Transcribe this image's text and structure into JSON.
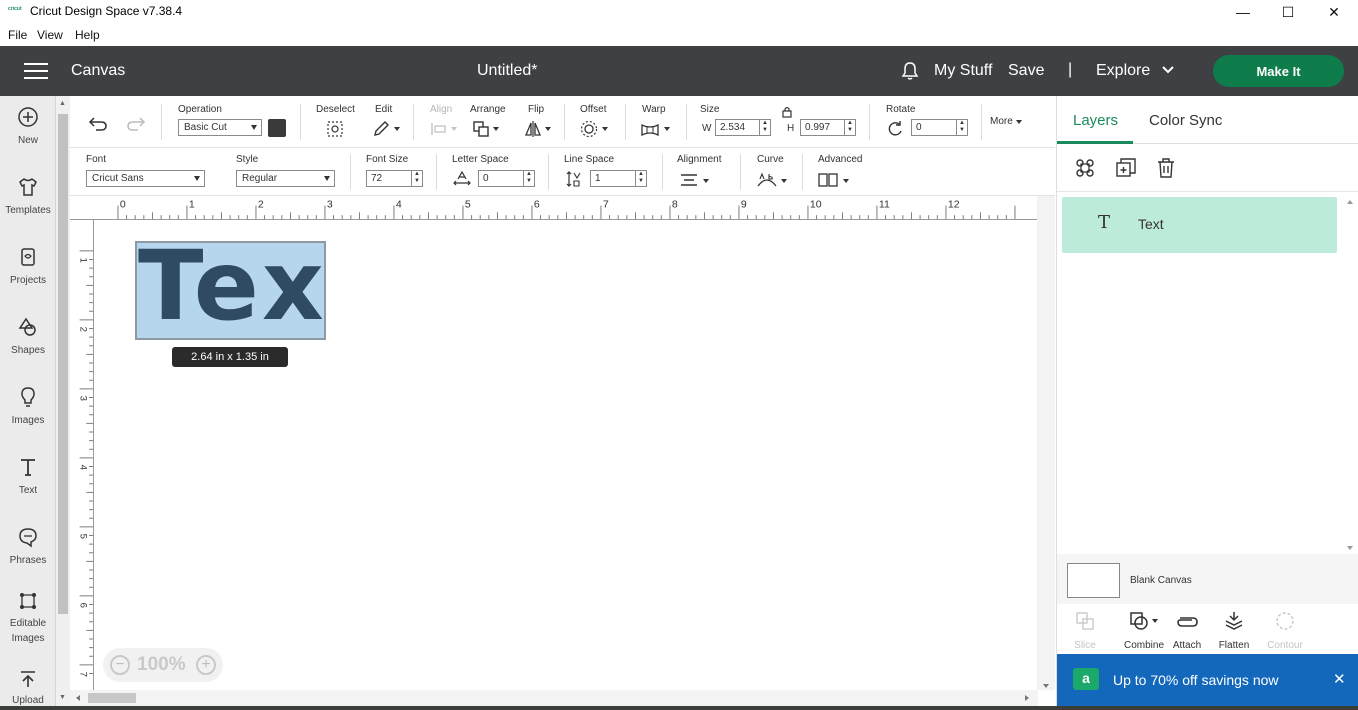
{
  "window": {
    "logo_text": "cricut",
    "title": "Cricut Design Space  v7.38.4",
    "minimize": "—",
    "maximize": "☐",
    "close": "✕"
  },
  "menu": [
    "File",
    "View",
    "Help"
  ],
  "header": {
    "section": "Canvas",
    "project_title": "Untitled*",
    "my_stuff": "My Stuff",
    "save": "Save",
    "separator": "|",
    "explore": "Explore",
    "make_it": "Make It"
  },
  "sidebar": {
    "items": [
      {
        "label": "New",
        "icon": "plus-circle-icon"
      },
      {
        "label": "Templates",
        "icon": "tshirt-icon"
      },
      {
        "label": "Projects",
        "icon": "projects-icon"
      },
      {
        "label": "Shapes",
        "icon": "shapes-icon"
      },
      {
        "label": "Images",
        "icon": "lightbulb-icon"
      },
      {
        "label": "Text",
        "icon": "text-icon"
      },
      {
        "label": "Phrases",
        "icon": "speech-bubble-icon"
      },
      {
        "label": "Editable Images",
        "icon": "editable-images-icon"
      },
      {
        "label": "Upload",
        "icon": "upload-icon"
      }
    ]
  },
  "toolbar1": {
    "operation_label": "Operation",
    "operation_value": "Basic Cut",
    "deselect": "Deselect",
    "edit": "Edit",
    "align": "Align",
    "arrange": "Arrange",
    "flip": "Flip",
    "offset": "Offset",
    "warp": "Warp",
    "size": "Size",
    "w_label": "W",
    "w_value": "2.534",
    "h_label": "H",
    "h_value": "0.997",
    "rotate": "Rotate",
    "rotate_value": "0",
    "more": "More"
  },
  "toolbar2": {
    "font_label": "Font",
    "font_value": "Cricut Sans",
    "style_label": "Style",
    "style_value": "Regular",
    "font_size_label": "Font Size",
    "font_size_value": "72",
    "letter_space_label": "Letter Space",
    "letter_space_value": "0",
    "line_space_label": "Line Space",
    "line_space_value": "1",
    "alignment_label": "Alignment",
    "curve_label": "Curve",
    "advanced_label": "Advanced"
  },
  "ruler": {
    "top": [
      "0",
      "1",
      "2",
      "3",
      "4",
      "5",
      "6",
      "7",
      "8",
      "9",
      "10",
      "11",
      "12"
    ],
    "left": [
      "1",
      "2",
      "3",
      "4",
      "5",
      "6",
      "7"
    ]
  },
  "canvas": {
    "text_object": "Text",
    "dimension_tag": "2.64  in x 1.35  in",
    "zoom": "100%",
    "selection_fill": "#b6d6ee",
    "text_color": "#2f4a63"
  },
  "right_panel": {
    "tab_layers": "Layers",
    "tab_color_sync": "Color Sync",
    "layer_name": "Text",
    "blank_canvas": "Blank Canvas",
    "tools": [
      {
        "label": "Slice",
        "disabled": true
      },
      {
        "label": "Combine",
        "disabled": false
      },
      {
        "label": "Attach",
        "disabled": false
      },
      {
        "label": "Flatten",
        "disabled": false
      },
      {
        "label": "Contour",
        "disabled": true
      }
    ],
    "promo": "Up to 70% off savings now",
    "promo_logo": "a",
    "accent": "#1b8a5a"
  }
}
